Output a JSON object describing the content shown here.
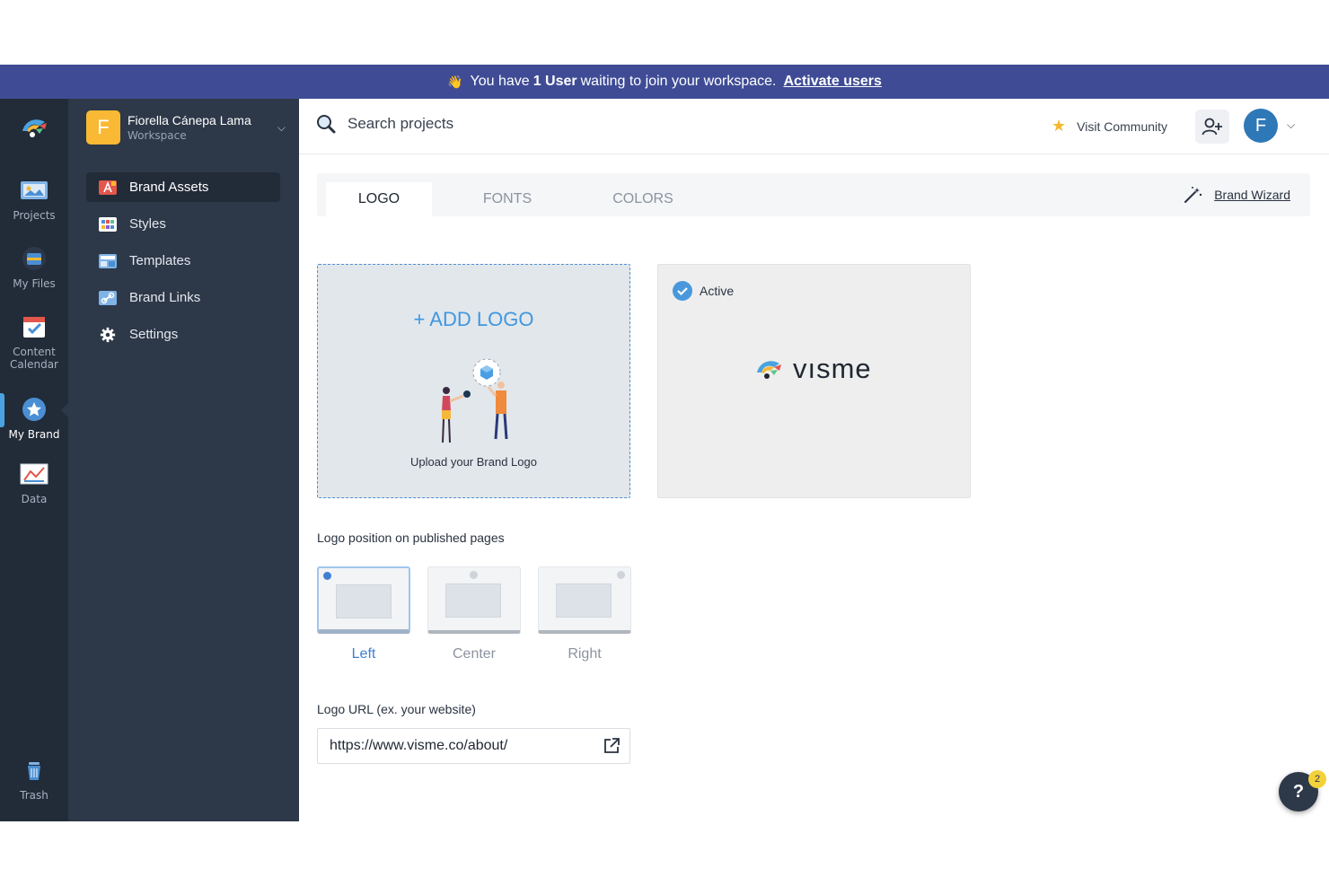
{
  "banner": {
    "pre": "You have",
    "count": "1 User",
    "post": "waiting to join your workspace.",
    "link": "Activate users"
  },
  "rail": {
    "items": [
      {
        "label": "Projects"
      },
      {
        "label": "My Files"
      },
      {
        "label": "Content"
      },
      {
        "label": "Calendar"
      },
      {
        "label": "My Brand"
      },
      {
        "label": "Data"
      },
      {
        "label": "Trash"
      }
    ]
  },
  "workspace": {
    "initial": "F",
    "name": "Fiorella Cánepa Lama",
    "subtitle": "Workspace"
  },
  "sidebar": {
    "items": [
      {
        "label": "Brand Assets"
      },
      {
        "label": "Styles"
      },
      {
        "label": "Templates"
      },
      {
        "label": "Brand Links"
      },
      {
        "label": "Settings"
      }
    ]
  },
  "header": {
    "search_placeholder": "Search projects",
    "community": "Visit Community",
    "user_initial": "F"
  },
  "tabs": [
    {
      "label": "LOGO"
    },
    {
      "label": "FONTS"
    },
    {
      "label": "COLORS"
    }
  ],
  "wizard": {
    "label": "Brand Wizard"
  },
  "upload": {
    "title": "+ ADD LOGO",
    "caption": "Upload your Brand Logo"
  },
  "logo_card": {
    "status": "Active",
    "brand": "vısme"
  },
  "position": {
    "label": "Logo position on published pages",
    "options": [
      {
        "label": "Left"
      },
      {
        "label": "Center"
      },
      {
        "label": "Right"
      }
    ],
    "selected": "Left"
  },
  "logo_url": {
    "label": "Logo URL (ex. your website)",
    "value": "https://www.visme.co/about/"
  },
  "help": {
    "label": "?",
    "badge": "2"
  },
  "colors": {
    "banner": "#3f4c95",
    "rail": "#222b38",
    "sidebar": "#2d3848",
    "accent": "#3f97e0",
    "workspace": "#f9b934"
  }
}
